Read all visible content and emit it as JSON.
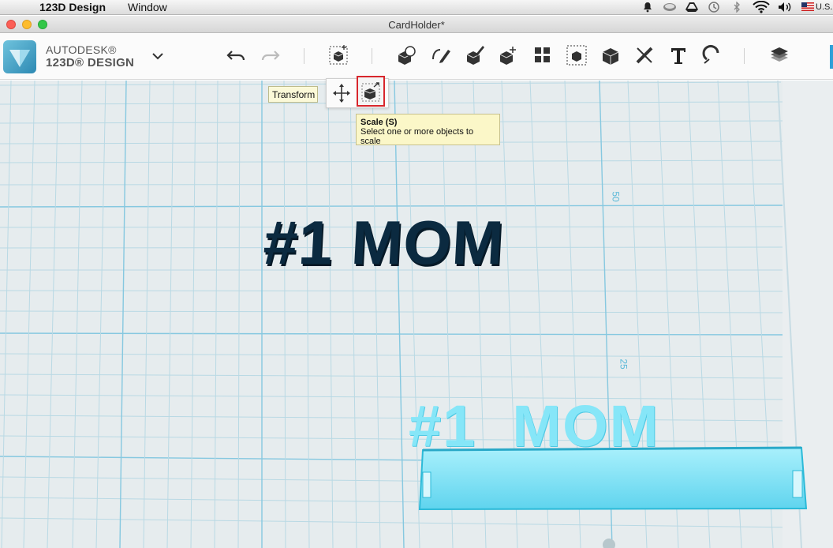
{
  "menubar": {
    "apple_glyph": "",
    "app_name": "123D Design",
    "menu_window": "Window",
    "keyboard_layout": "U.S."
  },
  "window": {
    "title": "CardHolder*"
  },
  "toolbar": {
    "brand_line1": "AUTODESK®",
    "brand_line2": "123D® DESIGN",
    "icons": [
      "undo-icon",
      "redo-icon",
      "transform-icon",
      "primitives-icon",
      "sketch-icon",
      "construct-icon",
      "modify-icon",
      "pattern-icon",
      "grouping-icon",
      "combine-icon",
      "measure-icon",
      "text-icon",
      "snap-icon",
      "material-icon"
    ]
  },
  "transform_menu": {
    "label": "Transform"
  },
  "tooltip": {
    "title": "Scale (S)",
    "description": "Select one or more objects to scale"
  },
  "viewport": {
    "grid_labels": [
      "50",
      "25"
    ],
    "text_dark": "#1 MOM",
    "text_selected": "#1  MOM"
  },
  "colors": {
    "accent": "#2fa0d8",
    "selection": "#7fe1f7",
    "dark_text": "#0b2a40",
    "grid_major": "#7fc8e3"
  }
}
